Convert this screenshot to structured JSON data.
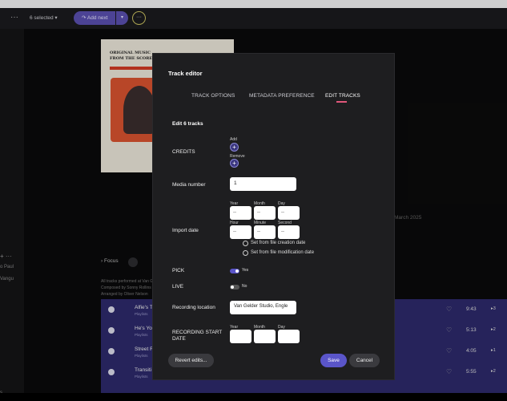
{
  "topbar": {
    "left_dots": "···",
    "selected_label": "6 selected ▾",
    "add_next_label": "↷ Add next",
    "add_next_drop": "▾",
    "more_label": "···"
  },
  "rail": {
    "plus": "+  ···",
    "item1": "o Paul",
    "item2": "Vangu",
    "item3": "s"
  },
  "album_art": {
    "line1": "ORIGINAL MUSIC",
    "line2": "FROM THE SCORE"
  },
  "background": {
    "date": "March 2025",
    "focus": "›  Focus",
    "credits_lines": [
      "All tracks performed at Van G",
      "Composed by Sonny Rollins",
      "Arranged by Oliver Nelson"
    ]
  },
  "tracks": [
    {
      "title": "Alfie's T",
      "sub": "Playlists",
      "duration": "9:43",
      "plays": "▸3"
    },
    {
      "title": "He's Yo",
      "sub": "Playlists",
      "duration": "5:13",
      "plays": "▸2"
    },
    {
      "title": "Street R",
      "sub": "Playlists",
      "duration": "4:05",
      "plays": "▸1"
    },
    {
      "title": "Transiti",
      "sub": "Playlists",
      "duration": "5:55",
      "plays": "▸2"
    }
  ],
  "modal": {
    "title": "Track editor",
    "tabs": [
      "TRACK OPTIONS",
      "METADATA PREFERENCE",
      "EDIT TRACKS"
    ],
    "edit_heading": "Edit 6 tracks",
    "credits_label": "CREDITS",
    "add_label": "Add",
    "remove_label": "Remove",
    "media_number_label": "Media number",
    "media_number_value": "1",
    "import_date_label": "Import date",
    "date_labels": [
      "Year",
      "Month",
      "Day"
    ],
    "time_labels": [
      "Hour",
      "Minute",
      "Second"
    ],
    "placeholder": "--",
    "radio_creation": "Set from file creation date",
    "radio_modification": "Set from file modification date",
    "pick_label": "PICK",
    "pick_value": "Yes",
    "live_label": "LIVE",
    "live_value": "No",
    "recording_location_label": "Recording location",
    "recording_location_value": "Van Gelder Studio, Engle",
    "recording_start_label_1": "RECORDING START",
    "recording_start_label_2": "DATE",
    "buttons": {
      "revert": "Revert edits...",
      "save": "Save",
      "cancel": "Cancel"
    }
  },
  "colors": {
    "accent": "#5a55c9",
    "tab_underline": "#e0577b",
    "tracklist_bg": "#2d2a6b"
  }
}
